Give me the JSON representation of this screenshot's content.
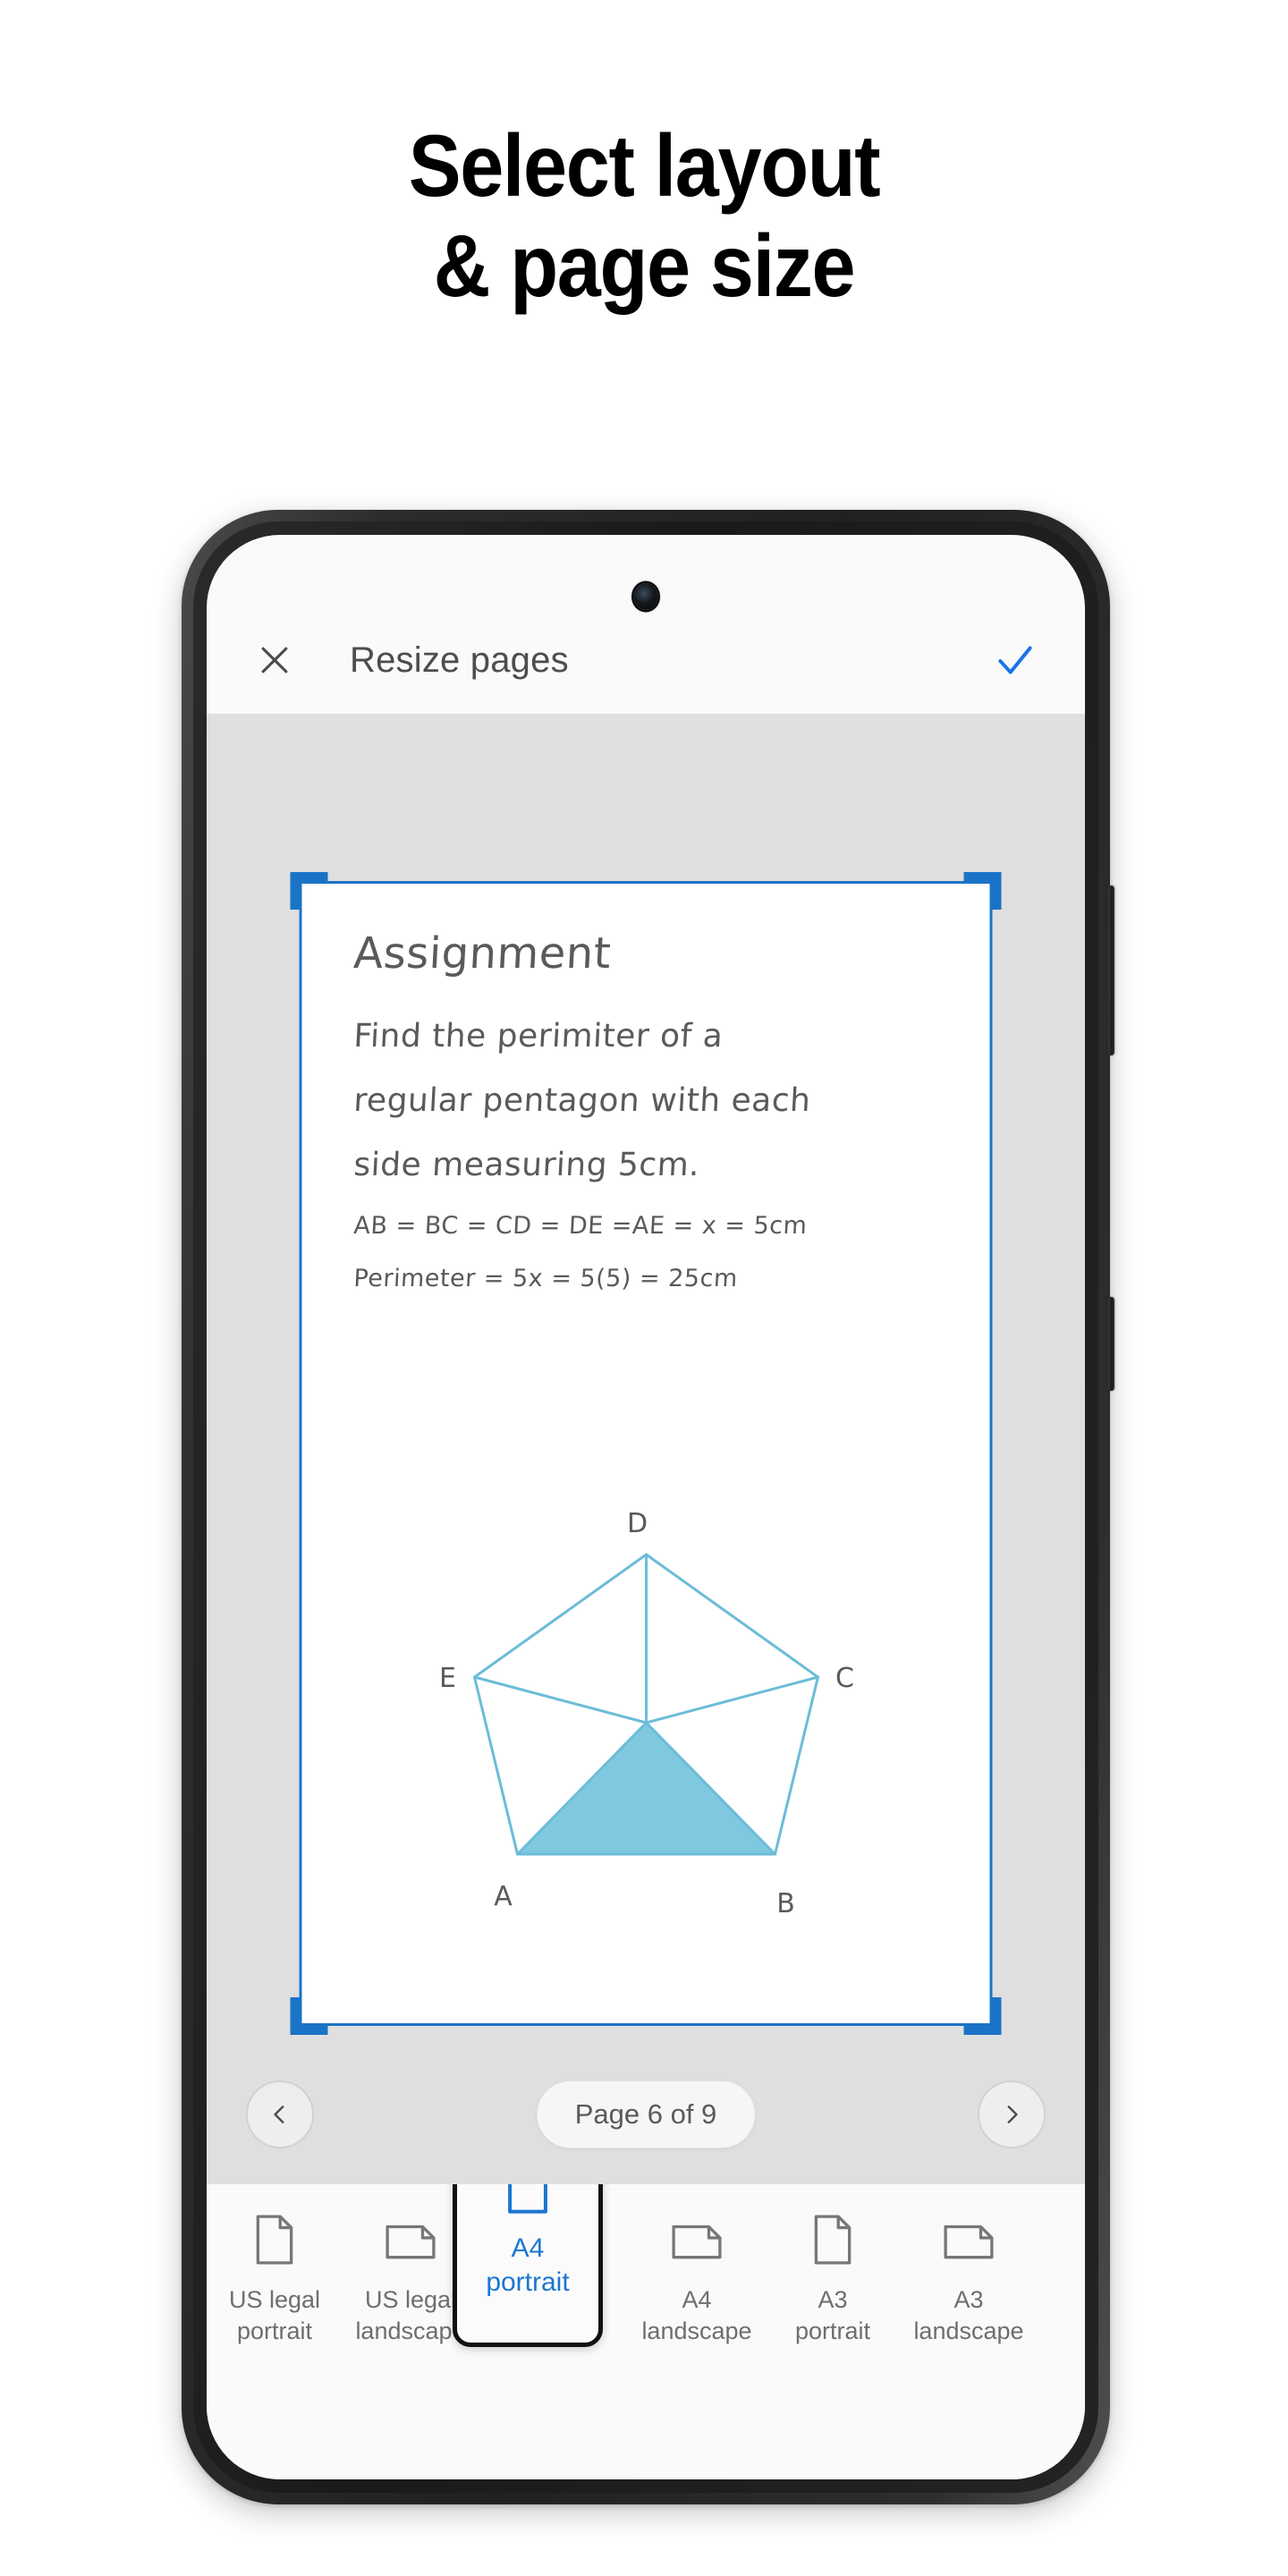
{
  "promo": {
    "line1": "Select layout",
    "line2": "& page size"
  },
  "phone": {
    "camera_icon": "front-camera",
    "side_buttons": [
      "volume-rocker",
      "power-button"
    ]
  },
  "app": {
    "toolbar": {
      "close_icon": "close-icon",
      "title": "Resize pages",
      "confirm_icon": "check-icon",
      "confirm_color": "#1a73e8"
    },
    "document": {
      "title": "Assignment",
      "paragraph_lines": [
        "Find the perimiter of a",
        "regular pentagon with each",
        "side measuring 5cm."
      ],
      "equations": [
        "AB = BC = CD = DE =AE = x = 5cm",
        "Perimeter = 5x = 5(5) = 25cm"
      ],
      "figure": {
        "type": "pentagon",
        "vertex_labels": [
          "D",
          "E",
          "C",
          "A",
          "B"
        ],
        "shaded_triangle": "center-A-B",
        "stroke_color": "#6cbcd8",
        "fill_color": "#7ec8e0"
      },
      "crop_frame_color": "#1a73c7"
    },
    "page_nav": {
      "prev_icon": "chevron-left-icon",
      "next_icon": "chevron-right-icon",
      "page_label": "Page 6 of 9",
      "current_page": 6,
      "total_pages": 9
    },
    "formats": {
      "selected_index": 2,
      "accent_color": "#1b76d2",
      "items": [
        {
          "name": "US legal portrait",
          "label": "US legal\nportrait",
          "icon": "document-portrait-icon",
          "orientation": "portrait"
        },
        {
          "name": "US legal landscape",
          "label": "US legal\nlandscape",
          "icon": "document-landscape-icon",
          "orientation": "landscape"
        },
        {
          "name": "A4 portrait",
          "label": "A4\nportrait",
          "icon": "document-portrait-icon",
          "orientation": "portrait"
        },
        {
          "name": "A4 landscape",
          "label": "A4\nlandscape",
          "icon": "document-landscape-icon",
          "orientation": "landscape"
        },
        {
          "name": "A3 portrait",
          "label": "A3\nportrait",
          "icon": "document-portrait-icon",
          "orientation": "portrait"
        },
        {
          "name": "A3 landscape",
          "label": "A3\nlandscape",
          "icon": "document-landscape-icon",
          "orientation": "landscape"
        }
      ]
    }
  }
}
